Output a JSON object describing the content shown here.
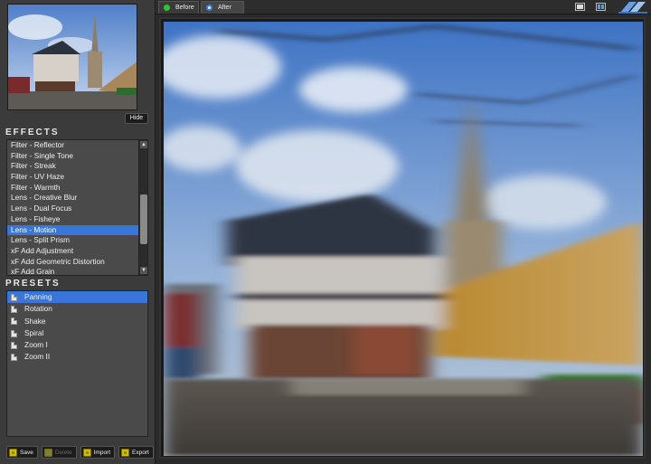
{
  "sidebar": {
    "hide_label": "Hide",
    "effects_title": "EFFECTS",
    "effects": [
      {
        "label": "Filter - Reflector"
      },
      {
        "label": "Filter - Single Tone"
      },
      {
        "label": "Filter - Streak"
      },
      {
        "label": "Filter - UV Haze"
      },
      {
        "label": "Filter - Warmth"
      },
      {
        "label": "Lens - Creative Blur"
      },
      {
        "label": "Lens - Dual Focus"
      },
      {
        "label": "Lens - Fisheye"
      },
      {
        "label": "Lens - Motion",
        "selected": true
      },
      {
        "label": "Lens - Split Prism"
      },
      {
        "label": "xF Add Adjustment"
      },
      {
        "label": "xF Add Geometric Distortion"
      },
      {
        "label": "xF Add Grain"
      }
    ],
    "presets_title": "PRESETS",
    "presets": [
      {
        "label": "Panning",
        "selected": true
      },
      {
        "label": "Rotation"
      },
      {
        "label": "Shake"
      },
      {
        "label": "Spiral"
      },
      {
        "label": "Zoom I"
      },
      {
        "label": "Zoom II"
      }
    ],
    "buttons": {
      "save": "Save",
      "delete": "Delete",
      "import": "Import",
      "export": "Export"
    }
  },
  "tabs": {
    "before": "Before",
    "after": "After"
  },
  "colors": {
    "selection": "#3a76d9",
    "before_dot": "#2ec52e",
    "after_dot": "#3b82e0"
  }
}
